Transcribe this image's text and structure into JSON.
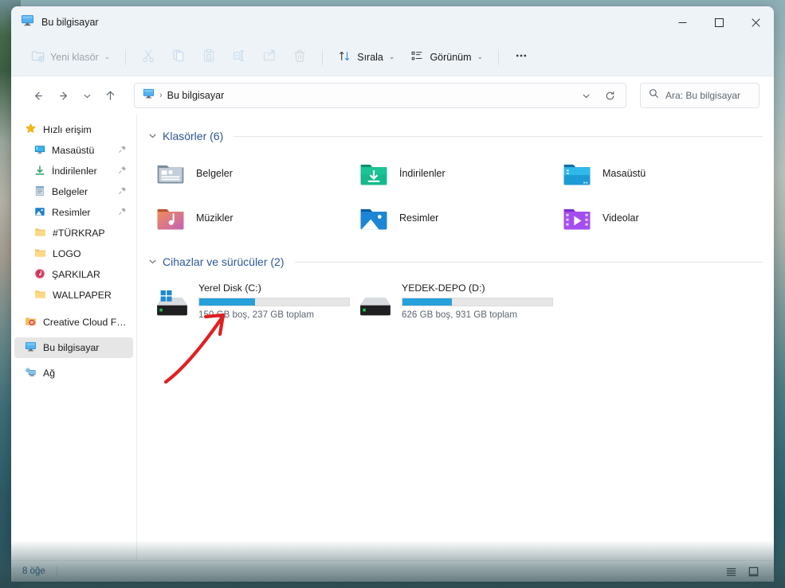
{
  "window": {
    "title": "Bu bilgisayar",
    "title_icon": "this-pc-icon",
    "controls": {
      "minimize": "—",
      "maximize": "□",
      "close": "✕"
    }
  },
  "commandbar": {
    "new_folder": {
      "label": "Yeni klasör",
      "icon": "new-folder-icon",
      "enabled": false
    },
    "cut": {
      "label": "Kes",
      "icon": "cut-icon",
      "enabled": false
    },
    "copy": {
      "label": "Kopyala",
      "icon": "copy-icon",
      "enabled": false
    },
    "paste": {
      "label": "Yapıştır",
      "icon": "paste-icon",
      "enabled": false
    },
    "rename": {
      "label": "Yeniden adlandır",
      "icon": "rename-icon",
      "enabled": false
    },
    "share": {
      "label": "Paylaş",
      "icon": "share-icon",
      "enabled": false
    },
    "delete": {
      "label": "Sil",
      "icon": "trash-icon",
      "enabled": false
    },
    "sort": {
      "label": "Sırala",
      "icon": "sort-icon",
      "enabled": true
    },
    "view": {
      "label": "Görünüm",
      "icon": "view-icon",
      "enabled": true
    },
    "more": {
      "label": "•••",
      "icon": "more-icon",
      "enabled": true
    },
    "chevron": "⌄"
  },
  "navbar": {
    "back": "←",
    "forward": "→",
    "recent": "⌄",
    "up": "↑",
    "breadcrumb": {
      "icon": "this-pc-icon",
      "separator": "›",
      "text": "Bu bilgisayar"
    },
    "dropdown": "⌄",
    "refresh": "↻"
  },
  "search": {
    "icon": "search-icon",
    "placeholder": "Ara: Bu bilgisayar",
    "value": ""
  },
  "sidebar": {
    "items": [
      {
        "label": "Hızlı erişim",
        "icon": "star-icon",
        "level": "root",
        "pinned": false,
        "selected": false
      },
      {
        "label": "Masaüstü",
        "icon": "desktop-icon",
        "level": "indent",
        "pinned": true,
        "selected": false
      },
      {
        "label": "İndirilenler",
        "icon": "downloads-icon",
        "level": "indent",
        "pinned": true,
        "selected": false
      },
      {
        "label": "Belgeler",
        "icon": "documents-icon",
        "level": "indent",
        "pinned": true,
        "selected": false
      },
      {
        "label": "Resimler",
        "icon": "pictures-icon",
        "level": "indent",
        "pinned": true,
        "selected": false
      },
      {
        "label": "#TÜRKRAP",
        "icon": "folder-icon",
        "level": "indent",
        "pinned": false,
        "selected": false
      },
      {
        "label": "LOGO",
        "icon": "folder-icon",
        "level": "indent",
        "pinned": false,
        "selected": false
      },
      {
        "label": "ŞARKILAR",
        "icon": "music-disc-icon",
        "level": "indent",
        "pinned": false,
        "selected": false
      },
      {
        "label": "WALLPAPER",
        "icon": "folder-icon",
        "level": "indent",
        "pinned": false,
        "selected": false
      },
      {
        "label": "Creative Cloud Files",
        "icon": "creative-cloud-icon",
        "level": "root",
        "pinned": false,
        "selected": false
      },
      {
        "label": "Bu bilgisayar",
        "icon": "this-pc-icon",
        "level": "root",
        "pinned": false,
        "selected": true
      },
      {
        "label": "Ağ",
        "icon": "network-icon",
        "level": "root",
        "pinned": false,
        "selected": false
      }
    ]
  },
  "content": {
    "folders_group": {
      "title": "Klasörler (6)",
      "collapse_glyph": "⌄",
      "items": [
        {
          "label": "Belgeler",
          "icon": "documents-folder-icon"
        },
        {
          "label": "İndirilenler",
          "icon": "downloads-folder-icon"
        },
        {
          "label": "Masaüstü",
          "icon": "desktop-folder-icon"
        },
        {
          "label": "Müzikler",
          "icon": "music-folder-icon"
        },
        {
          "label": "Resimler",
          "icon": "pictures-folder-icon"
        },
        {
          "label": "Videolar",
          "icon": "videos-folder-icon"
        }
      ]
    },
    "drives_group": {
      "title": "Cihazlar ve sürücüler (2)",
      "collapse_glyph": "⌄",
      "items": [
        {
          "name": "Yerel Disk (C:)",
          "icon": "windows-drive-icon",
          "free": "150 GB",
          "total": "237 GB",
          "sub": "150 GB boş, 237 GB toplam",
          "used_percent": 37,
          "bar_color": "#26a0da"
        },
        {
          "name": "YEDEK-DEPO (D:)",
          "icon": "hdd-drive-icon",
          "free": "626 GB",
          "total": "931 GB",
          "sub": "626 GB boş, 931 GB toplam",
          "used_percent": 33,
          "bar_color": "#26a0da"
        }
      ]
    },
    "annotation": {
      "name": "red-arrow-annotation",
      "color": "#e02020",
      "points_at": "Yerel Disk (C:)"
    }
  },
  "statusbar": {
    "item_count": "8 öğe",
    "details_view": "details-view-icon",
    "large_icons_view": "large-icons-view-icon"
  }
}
